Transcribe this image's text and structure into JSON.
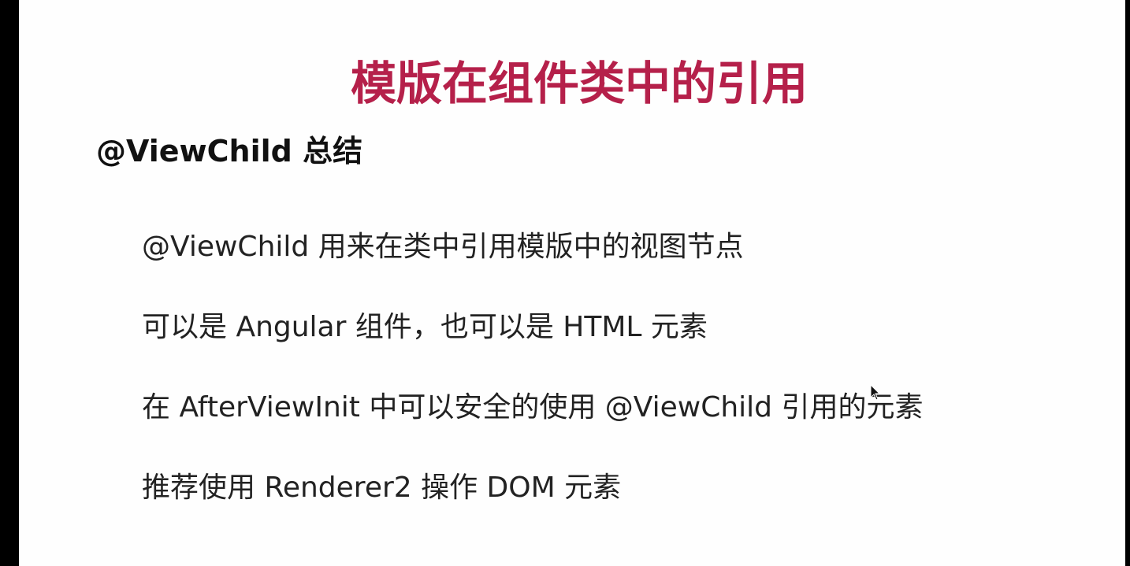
{
  "slide": {
    "title": "模版在组件类中的引用",
    "title_color": "#b5204a",
    "heading": "@ViewChild 总结",
    "bullets": [
      "@ViewChild 用来在类中引用模版中的视图节点",
      "可以是 Angular 组件，也可以是 HTML 元素",
      "在 AfterViewInit 中可以安全的使用 @ViewChild 引用的元素",
      "推荐使用 Renderer2 操作 DOM 元素"
    ]
  },
  "colors": {
    "background": "#fefefe",
    "frame": "#000000",
    "text": "#222222"
  },
  "icons": {
    "cursor": "mouse-pointer-icon"
  }
}
